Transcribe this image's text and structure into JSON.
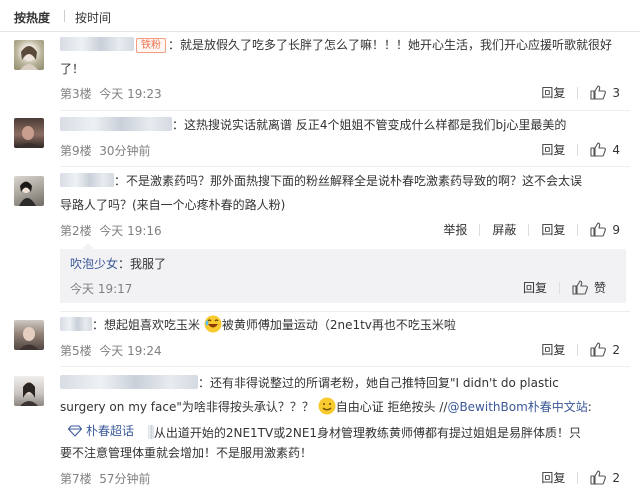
{
  "sort": {
    "hot_label": "按热度",
    "time_label": "按时间"
  },
  "comments": [
    {
      "badge": "铁粉",
      "text_line1": "：就是放假久了吃多了长胖了怎么了嘛！！！她开心生活，我们开心应援听歌就很好",
      "text_line2": "了！",
      "floor": "第3楼",
      "time": "今天 19:23",
      "reply_label": "回复",
      "likes": "3"
    },
    {
      "text_line1": "：这热搜说实话就离谱 反正4个姐姐不管变成什么样都是我们bj心里最美的",
      "floor": "第9楼",
      "time": "30分钟前",
      "reply_label": "回复",
      "likes": "4"
    },
    {
      "text_line1": "：不是激素药吗？那外面热搜下面的粉丝解释全是说朴春吃激素药导致的啊？这不会太误",
      "text_line2": "导路人了吗？(来自一个心疼朴春的路人粉)",
      "floor": "第2楼",
      "time": "今天 19:16",
      "report_label": "举报",
      "block_label": "屏蔽",
      "reply_label": "回复",
      "likes": "9",
      "sub_reply": {
        "name": "吹泡少女",
        "text": "：我服了",
        "time": "今天 19:17",
        "reply_label": "回复",
        "like_label": "赞"
      }
    },
    {
      "text_a": "：想起姐喜欢吃玉米",
      "text_b": "被黄师傅加量运动（2ne1tv再也不吃玉米啦",
      "floor": "第5楼",
      "time": "今天 19:24",
      "reply_label": "回复",
      "likes": "2"
    },
    {
      "text_line1": "：还有非得说整过的所谓老粉，她自己推特回复\"I didn't do plastic",
      "text_line2a": "surgery on my face\"为啥非得按头承认？？？",
      "text_line2b": "自由心证 拒绝按头 //",
      "mention": "@BewithBom朴春中文站",
      "text_line2c": ":",
      "topic": "朴春超话",
      "text_line3": "从出道开始的2NE1TV或2NE1身材管理教练黄师傅都有提过姐姐是易胖体质！只",
      "text_line4": "要不注意管理体重就会增加！不是服用激素药！",
      "floor": "第7楼",
      "time": "57分钟前",
      "reply_label": "回复",
      "likes": "2"
    }
  ]
}
